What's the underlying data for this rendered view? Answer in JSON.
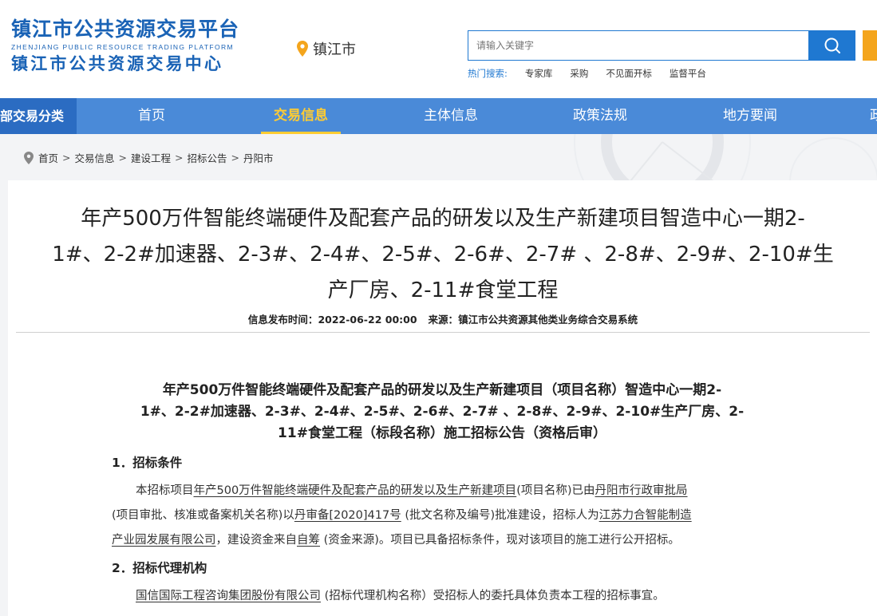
{
  "header": {
    "logo_cn_1": "镇江市公共资源交易平台",
    "logo_en": "ZHENJIANG PUBLIC RESOURCE TRADING PLATFORM",
    "logo_cn_2": "镇江市公共资源交易中心",
    "city": "镇江市",
    "search_placeholder": "请输入关键字",
    "hot_label": "热门搜索:",
    "hot_items": [
      "专家库",
      "采购",
      "不见面开标",
      "监督平台"
    ]
  },
  "nav": {
    "category": "全部交易分类",
    "items": [
      "首页",
      "交易信息",
      "主体信息",
      "政策法规",
      "地方要闻",
      "政"
    ],
    "active_index": 1
  },
  "breadcrumb": [
    "首页",
    "交易信息",
    "建设工程",
    "招标公告",
    "丹阳市"
  ],
  "article": {
    "title_line1": "年产500万件智能终端硬件及配套产品的研发以及生产新建项目智造中心一期2-",
    "title_line2": "1#、2-2#加速器、2-3#、2-4#、2-5#、2-6#、2-7# 、2-8#、2-9#、2-10#生",
    "title_line3": "产厂房、2-11#食堂工程",
    "publish_label": "信息发布时间：",
    "publish_time": "2022-06-22 00:00",
    "source_label": "来源：",
    "source": "镇江市公共资源其他类业务综合交易系统",
    "sub_title_line1": "年产500万件智能终端硬件及配套产品的研发以及生产新建项目（项目名称）智造中心一期2-",
    "sub_title_line2": "1#、2-2#加速器、2-3#、2-4#、2-5#、2-6#、2-7# 、2-8#、2-9#、2-10#生产厂房、2-",
    "sub_title_line3": "11#食堂工程（标段名称）施工招标公告（资格后审）",
    "section1_head": "1．招标条件",
    "s1_a": "本招标项目",
    "s1_project": "年产500万件智能终端硬件及配套产品的研发以及生产新建项目",
    "s1_b": "(项目名称)已由",
    "s1_approver": "丹阳市行政审批局",
    "s1_c": "(项目审批、核准或备案机关名称)以",
    "s1_doc": "丹审备[2020]417号",
    "s1_d": " (批文名称及编号)批准建设，招标人为",
    "s1_tenderer_a": "江苏力合智能制造",
    "s1_tenderer_b": "产业园发展有限公司",
    "s1_e": "，建设资金来自",
    "s1_fund": "自筹",
    "s1_f": " (资金来源)。项目已具备招标条件，现对该项目的施工进行公开招标。",
    "section2_head": "2．招标代理机构",
    "s2_agent": "国信国际工程咨询集团股份有限公司",
    "s2_text": " (招标代理机构名称）受招标人的委托具体负责本工程的招标事宜。"
  }
}
